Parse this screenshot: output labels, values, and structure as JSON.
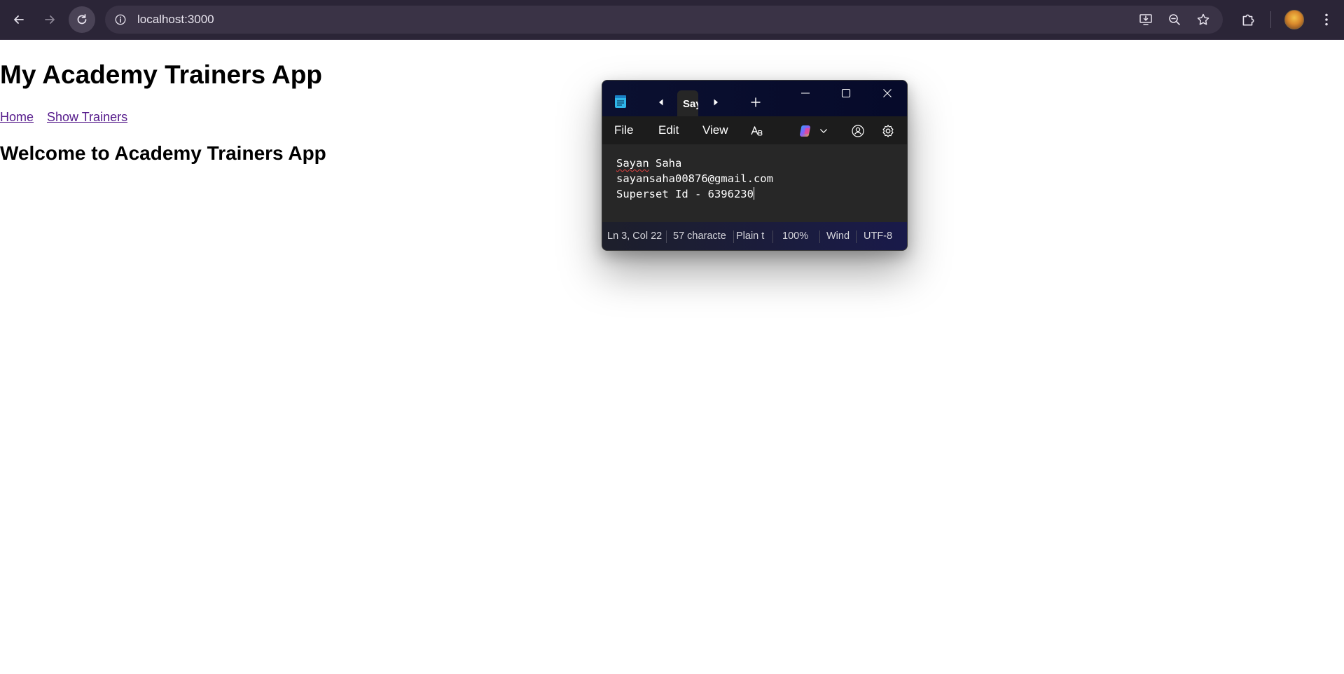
{
  "browser": {
    "url": "localhost:3000",
    "icons": {
      "back": "arrow-left-icon",
      "forward": "arrow-right-icon",
      "reload": "reload-icon",
      "site_info": "info-icon",
      "install": "install-app-icon",
      "zoom": "zoom-out-icon",
      "bookmark": "star-icon",
      "extensions": "puzzle-icon",
      "menu": "kebab-menu-icon"
    },
    "colors": {
      "toolbar_bg": "#2b2537",
      "omnibox_bg": "#3a3346"
    }
  },
  "page": {
    "title": "My Academy Trainers App",
    "nav": [
      {
        "label": "Home"
      },
      {
        "label": "Show Trainers"
      }
    ],
    "welcome_heading": "Welcome to Academy Trainers App",
    "link_color": "#551a8b"
  },
  "notepad": {
    "tab_title": "Say",
    "menu": {
      "file": "File",
      "edit": "Edit",
      "view": "View"
    },
    "content": {
      "line1_misspelled": "Sayan",
      "line1_rest": " Saha",
      "line2": "sayansaha00876@gmail.com",
      "line3": "Superset Id - 6396230"
    },
    "status": {
      "position": "Ln 3, Col 22",
      "characters": "57 characte",
      "format": "Plain t",
      "zoom": "100%",
      "line_ending": "Wind",
      "encoding": "UTF-8"
    }
  }
}
